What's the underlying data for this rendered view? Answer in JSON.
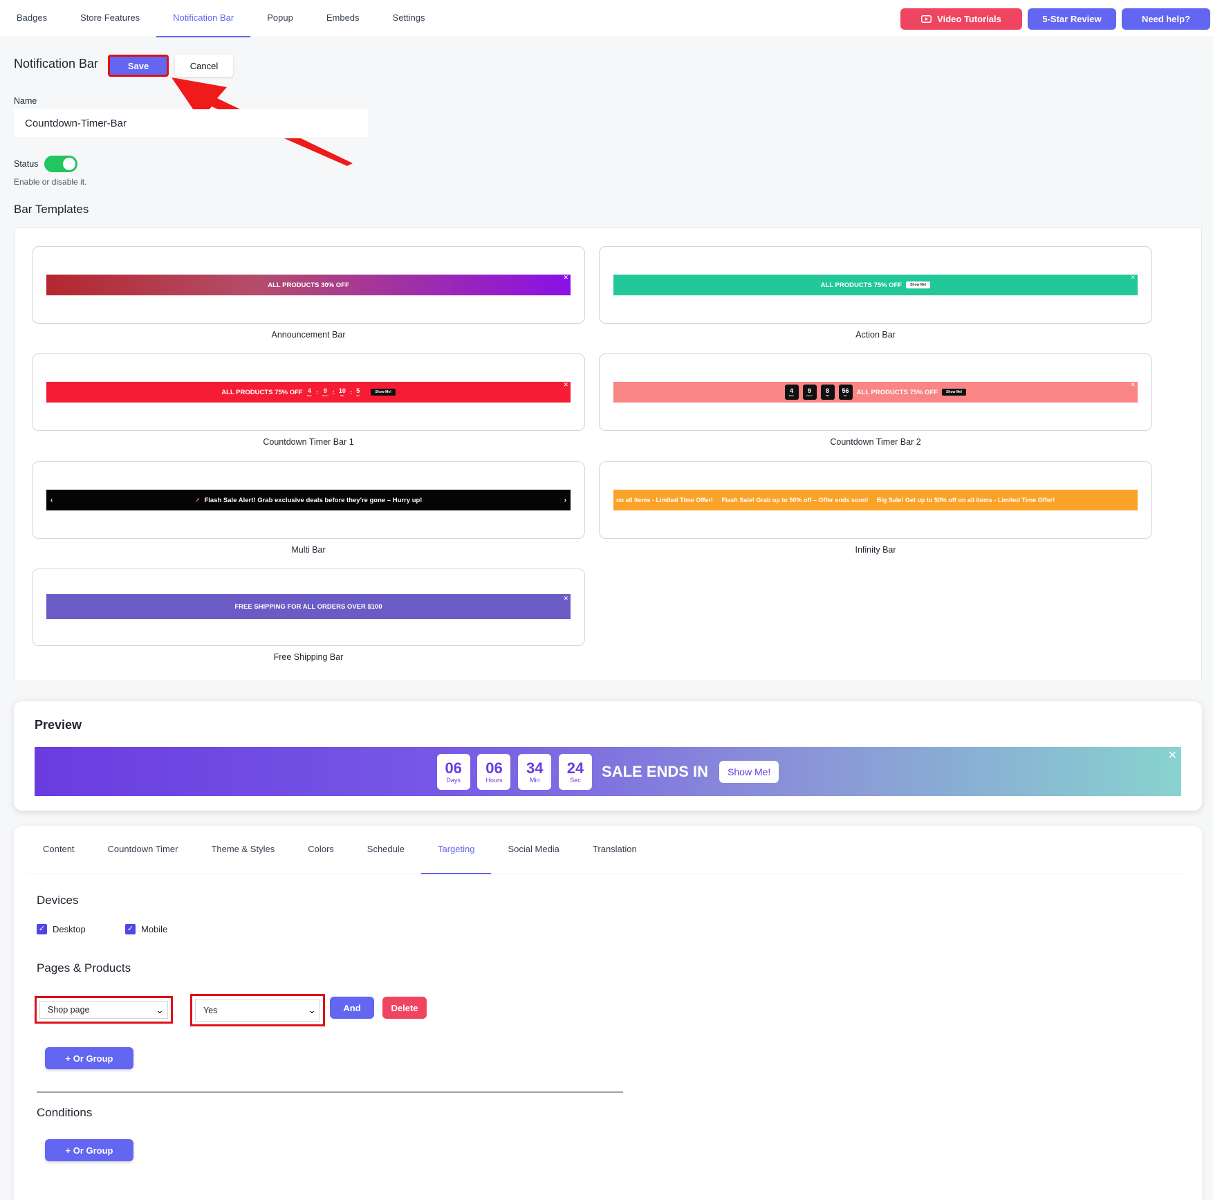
{
  "topnav": {
    "tabs": [
      "Badges",
      "Store Features",
      "Notification Bar",
      "Popup",
      "Embeds",
      "Settings"
    ],
    "active_tab": "Notification Bar",
    "buttons": {
      "video": "Video Tutorials",
      "review": "5-Star Review",
      "help": "Need help?"
    }
  },
  "header": {
    "title": "Notification Bar",
    "save": "Save",
    "cancel": "Cancel"
  },
  "form": {
    "name_label": "Name",
    "name_value": "Countdown-Timer-Bar",
    "status_label": "Status",
    "status_on": true,
    "status_hint": "Enable or disable it."
  },
  "templates": {
    "title": "Bar Templates",
    "items": [
      {
        "name": "Announcement Bar",
        "text": "ALL PRODUCTS 30% OFF"
      },
      {
        "name": "Action Bar",
        "text": "ALL PRODUCTS 75% OFF",
        "btn": "Show Me!"
      },
      {
        "name": "Countdown Timer Bar 1",
        "text": "ALL PRODUCTS 75% OFF",
        "btn": "Show Me!",
        "counts": [
          "4",
          "9",
          "10",
          "5"
        ],
        "units": [
          "Days",
          "Hours",
          "Min",
          "Sec"
        ]
      },
      {
        "name": "Countdown Timer Bar 2",
        "text": "ALL PRODUCTS 75% OFF",
        "btn": "Show Me!",
        "counts": [
          "4",
          "9",
          "8",
          "56"
        ],
        "units": [
          "Days",
          "Hours",
          "Min",
          "Sec"
        ]
      },
      {
        "name": "Multi Bar",
        "text": "Flash Sale Alert! Grab exclusive deals before they're gone – Hurry up!"
      },
      {
        "name": "Infinity Bar",
        "text": "on all items - Limited Time Offer!     Flash Sale! Grab up to 50% off – Offer ends soon!     Big Sale! Get up to 50% off on all items - Limited Time Offer!"
      },
      {
        "name": "Free Shipping Bar",
        "text": "FREE SHIPPING FOR ALL ORDERS OVER $100"
      }
    ]
  },
  "preview": {
    "title": "Preview",
    "counts": [
      {
        "num": "06",
        "unit": "Days"
      },
      {
        "num": "06",
        "unit": "Hours"
      },
      {
        "num": "34",
        "unit": "Min"
      },
      {
        "num": "24",
        "unit": "Sec"
      }
    ],
    "text": "SALE ENDS IN",
    "button": "Show Me!"
  },
  "settings": {
    "tabs": [
      "Content",
      "Countdown Timer",
      "Theme & Styles",
      "Colors",
      "Schedule",
      "Targeting",
      "Social Media",
      "Translation"
    ],
    "active_tab": "Targeting",
    "devices_title": "Devices",
    "devices": [
      {
        "label": "Desktop",
        "checked": true
      },
      {
        "label": "Mobile",
        "checked": true
      }
    ],
    "pages_title": "Pages & Products",
    "page_select": "Shop page",
    "value_select": "Yes",
    "and_btn": "And",
    "delete_btn": "Delete",
    "or_group_btn": "+ Or Group",
    "conditions_title": "Conditions",
    "conditions_or_group_btn": "+ Or Group"
  },
  "colors": {
    "accent": "#6366f1",
    "danger": "#ef4561",
    "success": "#22c55e",
    "highlight": "#e0101a"
  }
}
